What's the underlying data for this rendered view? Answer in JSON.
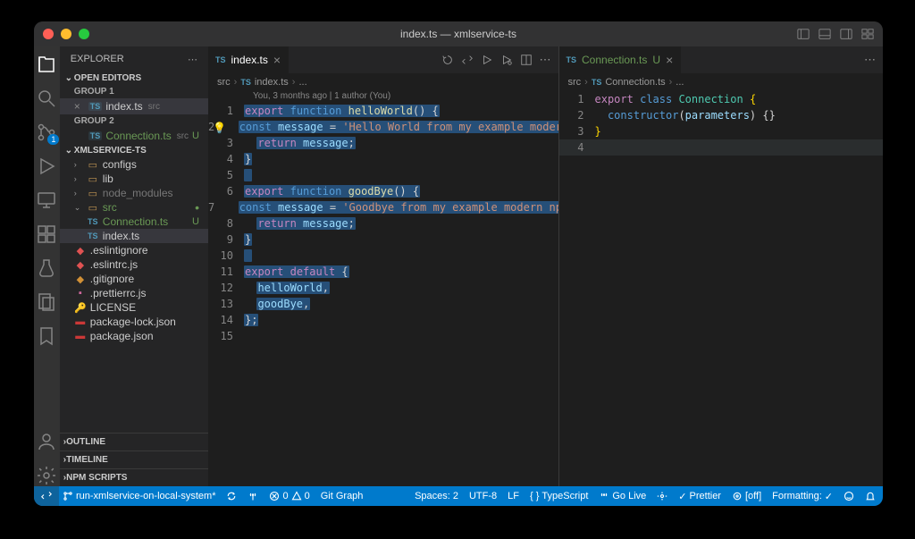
{
  "window": {
    "title": "index.ts — xmlservice-ts"
  },
  "sidebar": {
    "title": "EXPLORER",
    "open_editors_label": "OPEN EDITORS",
    "group1": "GROUP 1",
    "group2": "GROUP 2",
    "editor1": {
      "name": "index.ts",
      "dir": "src"
    },
    "editor2": {
      "name": "Connection.ts",
      "dir": "src",
      "status": "U"
    },
    "project": "XMLSERVICE-TS",
    "tree": {
      "configs": "configs",
      "lib": "lib",
      "node_modules": "node_modules",
      "src": "src",
      "connection": "Connection.ts",
      "index": "index.ts",
      "eslintignore": ".eslintignore",
      "eslintrc": ".eslintrc.js",
      "gitignore": ".gitignore",
      "prettierrc": ".prettierrc.js",
      "license": "LICENSE",
      "pkglock": "package-lock.json",
      "pkg": "package.json"
    },
    "outline": "OUTLINE",
    "timeline": "TIMELINE",
    "npm": "NPM SCRIPTS"
  },
  "scm_badge": "1",
  "editor1": {
    "tab": "index.ts",
    "crumb": [
      "src",
      "index.ts",
      "..."
    ],
    "codelens": "You, 3 months ago | 1 author (You)",
    "lines": [
      "1",
      "2",
      "3",
      "4",
      "5",
      "6",
      "7",
      "8",
      "9",
      "10",
      "11",
      "12",
      "13",
      "14",
      "15"
    ],
    "l1": {
      "a": "export",
      "b": "function",
      "c": "helloWorld",
      "d": "() {"
    },
    "l2": {
      "a": "const",
      "b": "message",
      "c": "=",
      "d": "'Hello World from my example modern npm package"
    },
    "l3": {
      "a": "return",
      "b": "message",
      "c": ";"
    },
    "l4": "}",
    "l6": {
      "a": "export",
      "b": "function",
      "c": "goodBye",
      "d": "() {"
    },
    "l7": {
      "a": "const",
      "b": "message",
      "c": "=",
      "d": "'Goodbye from my example modern npm package!'",
      "e": ";"
    },
    "l8": {
      "a": "return",
      "b": "message",
      "c": ";"
    },
    "l9": "}",
    "l11": {
      "a": "export",
      "b": "default",
      "c": "{"
    },
    "l12": {
      "a": "helloWorld",
      "b": ","
    },
    "l13": {
      "a": "goodBye",
      "b": ","
    },
    "l14": "};"
  },
  "editor2": {
    "tab": "Connection.ts",
    "u": "U",
    "crumb": [
      "src",
      "Connection.ts",
      "..."
    ],
    "lines": [
      "1",
      "2",
      "3",
      "4"
    ],
    "l1": {
      "a": "export",
      "b": "class",
      "c": "Connection",
      "d": "{"
    },
    "l2": {
      "a": "constructor",
      "b": "(",
      "c": "parameters",
      "d": ")",
      "e": "{}"
    },
    "l3": "}"
  },
  "status": {
    "branch": "run-xmlservice-on-local-system*",
    "errors": "0",
    "warnings": "0",
    "gitgraph": "Git Graph",
    "spaces": "Spaces: 2",
    "encoding": "UTF-8",
    "eol": "LF",
    "lang": "TypeScript",
    "golive": "Go Live",
    "prettier": "Prettier",
    "spell": "[off]",
    "formatting": "Formatting:"
  }
}
